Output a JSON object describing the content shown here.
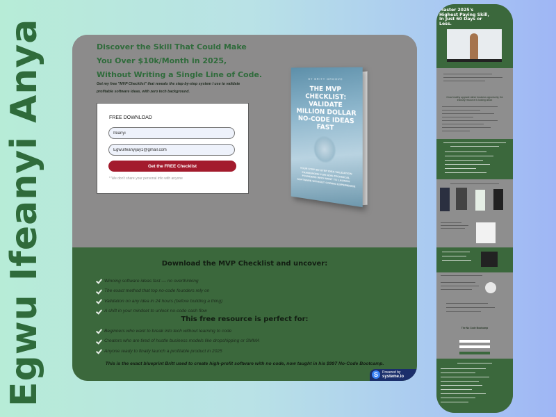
{
  "side_title": "Egwu Ifeanyi Anya",
  "hero": {
    "headline": "Discover the Skill That Could Make You Over $10k/Month in 2025, Without Writing a Single Line of Code.",
    "subtext": "Get my free \"MVP Checklist\" that reveals the step-by-step system I use to validate profitable software ideas, with zero tech background."
  },
  "form": {
    "label": "FREE DOWNLOAD",
    "name_value": "Ifeanyi",
    "email_value": "Egwuifeanyijay1@gmail.com",
    "submit_label": "Get the FREE Checklist",
    "privacy_note": "* We don't share your personal info with anyone"
  },
  "book": {
    "author": "BY BRITT GROOVE",
    "title": "THE MVP CHECKLIST: VALIDATE MILLION DOLLAR NO-CODE IDEAS FAST",
    "subtitle": "YOUR STEP-BY-STEP IDEA VALIDATION FRAMEWORK FOR NON-TECHNICAL FOUNDERS WHO WANT TO LAUNCH SOFTWARE WITHOUT CODING EXPERIENCE"
  },
  "uncover": {
    "heading": "Download the MVP Checklist and uncover:",
    "items": [
      "Winning software ideas fast — no overthinking",
      "The exact method that top no-code founders rely on",
      "Validation on any idea in 24 hours (before building a thing)",
      "A shift in your mindset to unlock no-code cash flow"
    ]
  },
  "perfect_for": {
    "heading": "This free resource is perfect for:",
    "items": [
      "Beginners who want to break into tech without learning to code",
      "Creators who are tired of hustle business models like dropshipping or SMMA",
      "Anyone ready to finally launch a profitable product in 2025"
    ]
  },
  "closing": "This is the exact blueprint Britt used to create high-profit software with no code, now taught in his $997 No-Code Bootcamp.",
  "badge": {
    "line1": "Powered by",
    "line2": "systeme.io"
  },
  "preview": {
    "title": "Master 2025's Highest Paying Skill, In Just 60 Days or Less.",
    "video_icon": "play-icon",
    "heading1": "Grow healthy upgrade rather business opportunity, the industry resource is looking about",
    "form_title": "The No Code Bootcamp"
  }
}
